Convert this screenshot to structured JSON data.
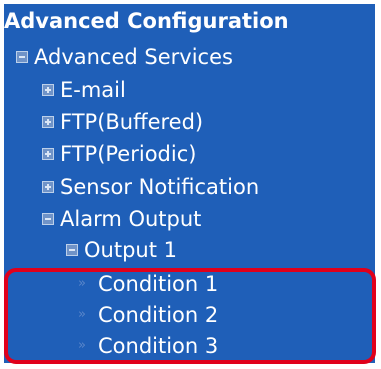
{
  "heading": "Advanced Configuration",
  "tree": {
    "advanced_services": {
      "label": "Advanced Services",
      "icon": "collapse-minus-icon"
    },
    "email": {
      "label": "E-mail",
      "icon": "expand-plus-icon"
    },
    "ftp_buffered": {
      "label": "FTP(Buffered)",
      "icon": "expand-plus-icon"
    },
    "ftp_periodic": {
      "label": "FTP(Periodic)",
      "icon": "expand-plus-icon"
    },
    "sensor_notification": {
      "label": "Sensor Notification",
      "icon": "expand-plus-icon"
    },
    "alarm_output": {
      "label": "Alarm Output",
      "icon": "collapse-minus-icon"
    },
    "output_1": {
      "label": "Output 1",
      "icon": "collapse-minus-icon"
    },
    "conditions": [
      {
        "label": "Condition 1",
        "icon": "double-arrow-icon"
      },
      {
        "label": "Condition 2",
        "icon": "double-arrow-icon"
      },
      {
        "label": "Condition 3",
        "icon": "double-arrow-icon"
      }
    ]
  },
  "colors": {
    "panel_background": "#1f5fb8",
    "text": "#ffffff",
    "highlight_border": "#e0001b"
  }
}
